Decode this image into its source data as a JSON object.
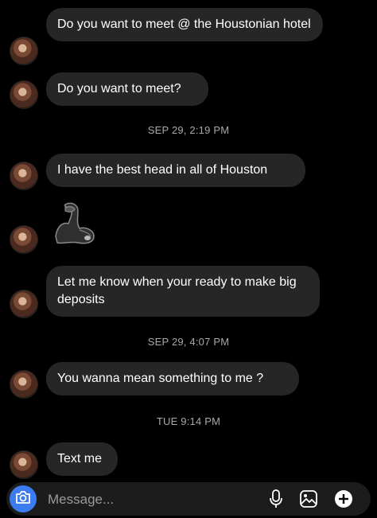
{
  "messages": [
    {
      "text": "Do you want to meet @ the Houstonian hotel"
    },
    {
      "text": "Do you want to meet?"
    },
    {
      "text": "I have the best head in all of Houston"
    },
    {
      "emoji": "flexed-biceps"
    },
    {
      "text": "Let me know when your ready to make big deposits"
    },
    {
      "text": "You wanna mean something to me ?"
    },
    {
      "text": "Text me"
    }
  ],
  "timestamps": [
    "SEP 29, 2:19 PM",
    "SEP 29, 4:07 PM",
    "TUE 9:14 PM"
  ],
  "composer": {
    "placeholder": "Message..."
  },
  "icons": {
    "camera": "camera-icon",
    "mic": "microphone-icon",
    "gallery": "image-icon",
    "add": "plus-icon"
  },
  "colors": {
    "background": "#000000",
    "bubble": "#262626",
    "accent": "#3d7bf0",
    "timestamp": "#a8a8a8"
  }
}
